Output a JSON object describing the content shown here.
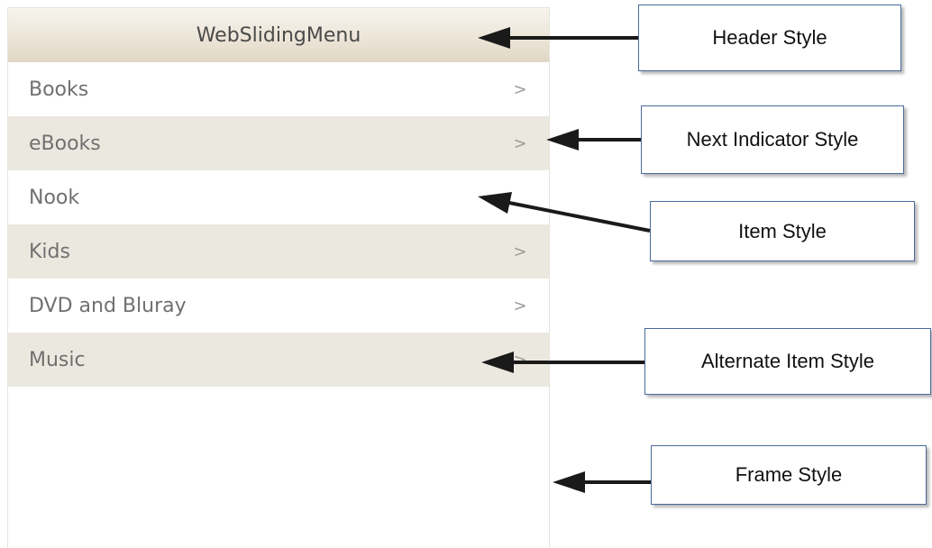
{
  "menu": {
    "header_title": "WebSlidingMenu",
    "next_indicator_glyph": ">",
    "items": [
      {
        "label": "Books",
        "has_next": true,
        "alternate": false
      },
      {
        "label": "eBooks",
        "has_next": true,
        "alternate": true
      },
      {
        "label": "Nook",
        "has_next": false,
        "alternate": false
      },
      {
        "label": "Kids",
        "has_next": true,
        "alternate": true
      },
      {
        "label": "DVD and Bluray",
        "has_next": true,
        "alternate": false
      },
      {
        "label": "Music",
        "has_next": true,
        "alternate": true
      }
    ]
  },
  "annotations": {
    "header_style": "Header Style",
    "next_indicator_style": "Next Indicator Style",
    "item_style": "Item Style",
    "alternate_item_style": "Alternate Item Style",
    "frame_style": "Frame Style"
  },
  "colors": {
    "alternate_row": "#ebe9df",
    "callout_border": "#4a6a9c",
    "arrow": "#1a1a1a"
  }
}
